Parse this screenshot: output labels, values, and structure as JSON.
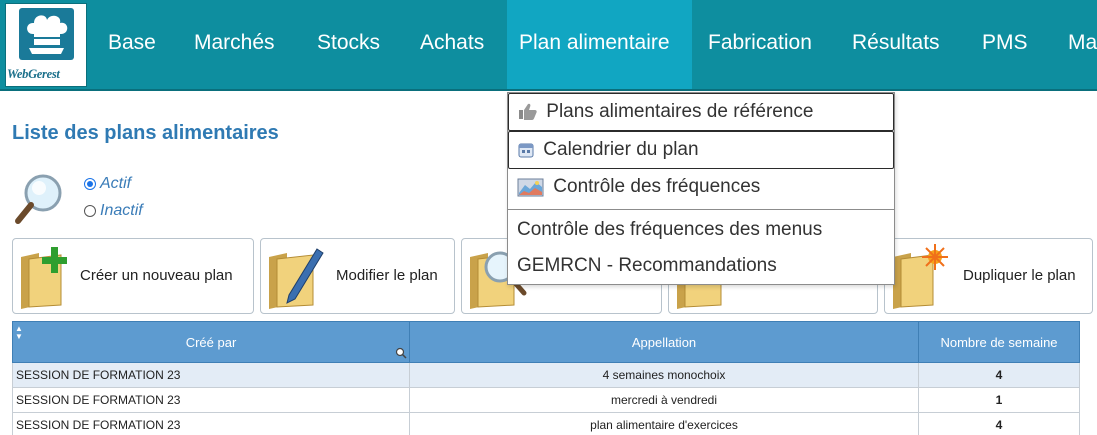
{
  "app": {
    "logo_text": "WebGerest"
  },
  "nav": {
    "items": [
      {
        "label": "Base",
        "active": false
      },
      {
        "label": "Marchés",
        "active": false
      },
      {
        "label": "Stocks",
        "active": false
      },
      {
        "label": "Achats",
        "active": false
      },
      {
        "label": "Plan alimentaire",
        "active": true
      },
      {
        "label": "Fabrication",
        "active": false
      },
      {
        "label": "Résultats",
        "active": false
      },
      {
        "label": "PMS",
        "active": false
      },
      {
        "label": "Ma",
        "active": false
      }
    ]
  },
  "dropdown": {
    "items": [
      {
        "label": "Plans alimentaires de référence",
        "icon": "thumbs-up-icon"
      },
      {
        "label": "Calendrier du plan",
        "icon": "calendar-icon"
      },
      {
        "label": "Contrôle des fréquences",
        "icon": "chart-image-icon"
      },
      {
        "label": "Contrôle des fréquences des menus",
        "icon": ""
      },
      {
        "label": "GEMRCN - Recommandations",
        "icon": ""
      }
    ]
  },
  "page": {
    "title": "Liste des plans alimentaires"
  },
  "filter": {
    "options": [
      {
        "label": "Actif",
        "checked": true
      },
      {
        "label": "Inactif",
        "checked": false
      }
    ]
  },
  "actions": [
    {
      "label": "Créer un nouveau plan",
      "icon": "folder-add-icon"
    },
    {
      "label": "Modifier le plan",
      "icon": "folder-edit-icon"
    },
    {
      "label": "",
      "icon": "folder-search-icon"
    },
    {
      "label": "",
      "icon": "folder-icon"
    },
    {
      "label": "Dupliquer le plan",
      "icon": "folder-duplicate-icon"
    }
  ],
  "table": {
    "columns": [
      "Créé par",
      "Appellation",
      "Nombre de semaine"
    ],
    "rows": [
      {
        "cree_par": "SESSION DE FORMATION 23",
        "appellation": "4 semaines monochoix",
        "semaines": "4",
        "highlighted": true
      },
      {
        "cree_par": "SESSION DE FORMATION 23",
        "appellation": "mercredi à vendredi",
        "semaines": "1",
        "highlighted": false
      },
      {
        "cree_par": "SESSION DE FORMATION 23",
        "appellation": "plan alimentaire d'exercices",
        "semaines": "4",
        "highlighted": false
      }
    ]
  },
  "colors": {
    "nav_bg": "#0e8e9f",
    "nav_active": "#11a6c2",
    "table_header": "#5d9bd0",
    "title": "#2f7ab3"
  }
}
